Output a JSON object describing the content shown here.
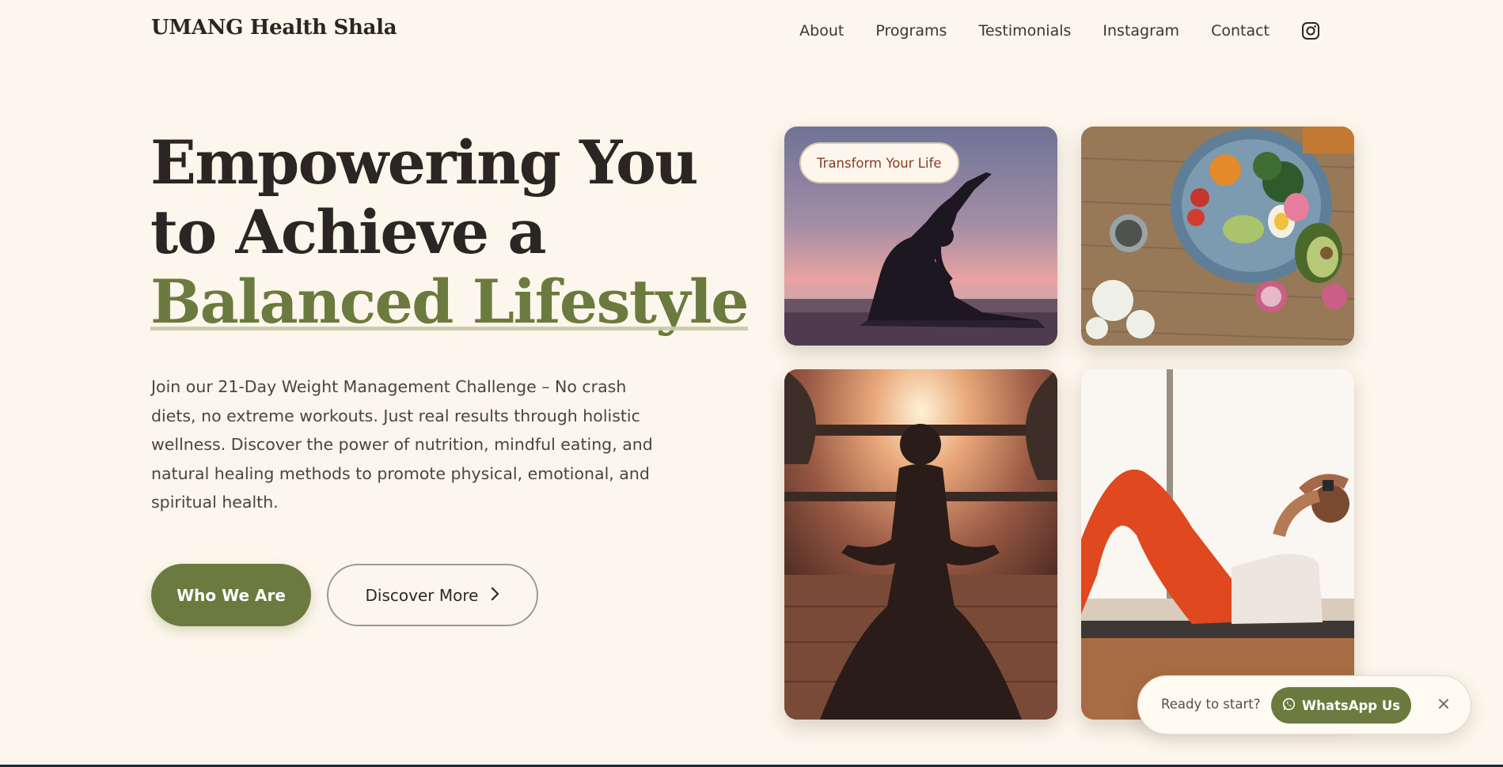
{
  "header": {
    "logo": "UMANG Health Shala",
    "nav": [
      "About",
      "Programs",
      "Testimonials",
      "Instagram",
      "Contact"
    ],
    "nav_icon": "instagram-icon"
  },
  "hero": {
    "headline_line1": "Empowering You",
    "headline_line2": "to Achieve a",
    "headline_accent": "Balanced Lifestyle",
    "intro": "Join our 21-Day Weight Management Challenge – No crash diets, no extreme workouts. Just real results through holistic wellness. Discover the power of nutrition, mindful eating, and natural healing methods to promote physical, emotional, and spiritual health.",
    "primary_button": "Who We Are",
    "secondary_button": "Discover More",
    "secondary_icon": "chevron-right-icon"
  },
  "gallery": {
    "badge": "Transform Your Life",
    "images": [
      "yoga-sunset-pose",
      "healthy-salad-bowl",
      "meditation-sunrise",
      "floor-exercise"
    ]
  },
  "whatsapp": {
    "prompt": "Ready to start?",
    "button": "WhatsApp Us",
    "icon": "whatsapp-icon",
    "close": "×"
  },
  "colors": {
    "background": "#fdf6ec",
    "accent": "#6b7a3e",
    "badge_text": "#8b3a22",
    "text": "#2d2a26"
  }
}
